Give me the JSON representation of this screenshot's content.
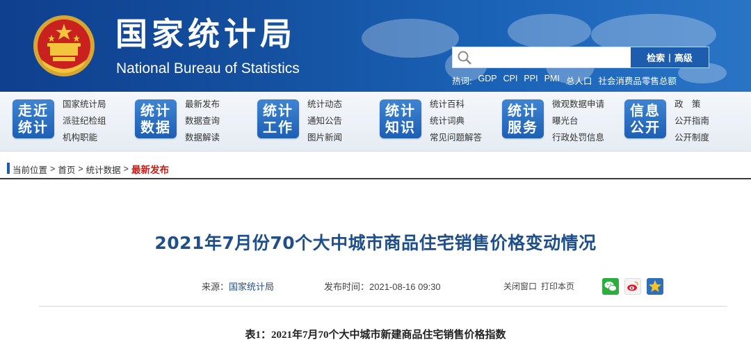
{
  "header": {
    "site_title": "国家统计局",
    "site_subtitle": "National Bureau of Statistics",
    "search": {
      "value": "",
      "button_label_primary": "检索",
      "button_separator": "|",
      "button_label_secondary": "高级"
    },
    "hot_words": {
      "label": "热词:",
      "items": [
        "GDP",
        "CPI",
        "PPI",
        "PMI",
        "总人口",
        "社会消费品零售总额"
      ]
    }
  },
  "nav": {
    "groups": [
      {
        "badge_line1": "走近",
        "badge_line2": "统计",
        "links": [
          "国家统计局",
          "派驻纪检组",
          "机构职能"
        ]
      },
      {
        "badge_line1": "统计",
        "badge_line2": "数据",
        "links": [
          "最新发布",
          "数据查询",
          "数据解读"
        ]
      },
      {
        "badge_line1": "统计",
        "badge_line2": "工作",
        "links": [
          "统计动态",
          "通知公告",
          "图片新闻"
        ]
      },
      {
        "badge_line1": "统计",
        "badge_line2": "知识",
        "links": [
          "统计百科",
          "统计词典",
          "常见问题解答"
        ]
      },
      {
        "badge_line1": "统计",
        "badge_line2": "服务",
        "links": [
          "微观数据申请",
          "曝光台",
          "行政处罚信息"
        ]
      },
      {
        "badge_line1": "信息",
        "badge_line2": "公开",
        "links": [
          "政　策",
          "公开指南",
          "公开制度"
        ]
      }
    ]
  },
  "breadcrumb": {
    "label": "当前位置",
    "separator": ">",
    "items": [
      "首页",
      "统计数据"
    ],
    "current": "最新发布"
  },
  "article": {
    "title": "2021年7月份70个大中城市商品住宅销售价格变动情况",
    "source_label": "来源：",
    "source_value": "国家统计局",
    "time_label": "发布时间：",
    "time_value": "2021-08-16 09:30",
    "close_window": "关闭窗口",
    "print_page": "打印本页",
    "table_caption": "表1：2021年7月70个大中城市新建商品住宅销售价格指数"
  },
  "colors": {
    "banner_blue": "#14509f",
    "nav_badge_blue": "#1d5fb4",
    "title_blue": "#1f4f8a",
    "current_crumb_red": "#c8201c"
  },
  "icons": {
    "emblem": "national-emblem-icon",
    "search": "search-icon",
    "wechat": "wechat-share-icon",
    "weibo": "weibo-share-icon",
    "favorite": "favorite-star-icon"
  }
}
